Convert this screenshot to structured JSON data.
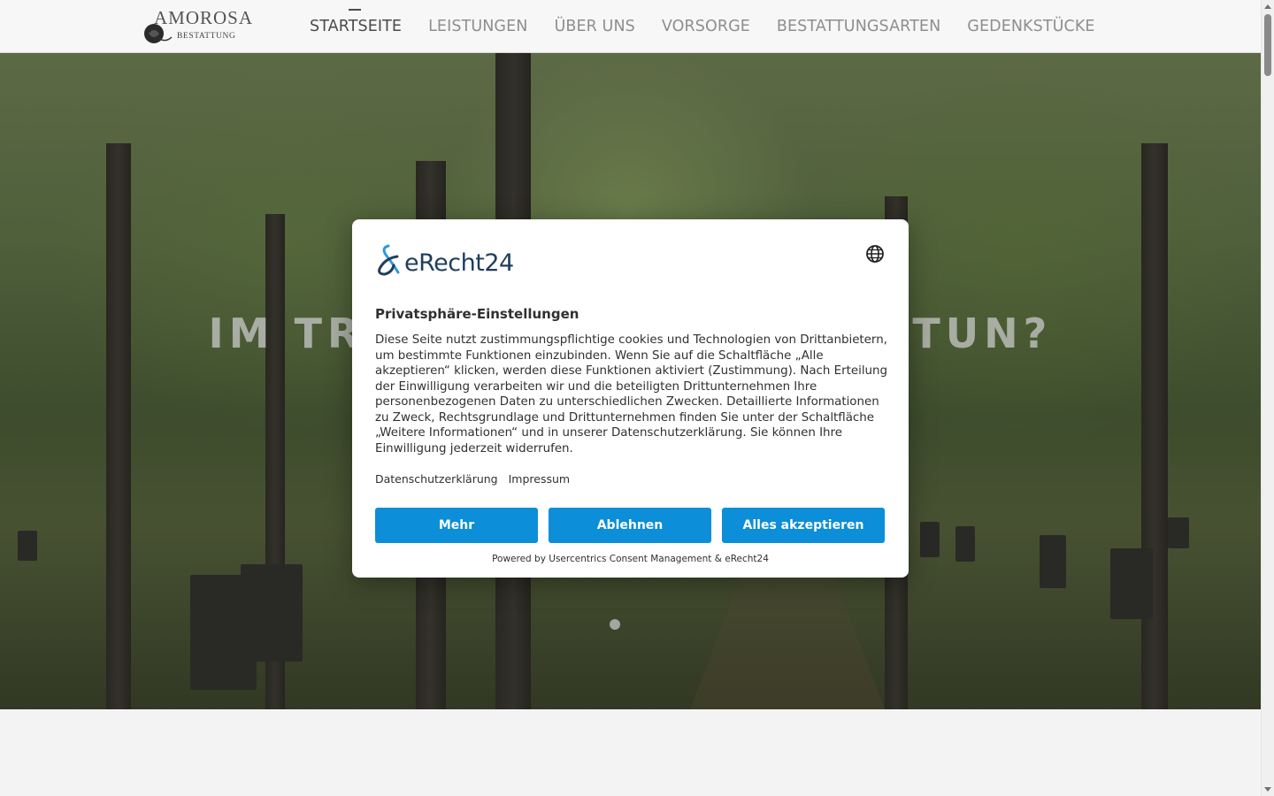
{
  "header": {
    "logo": {
      "wordmark": "AMOROSA",
      "subtitle": "BESTATTUNG"
    },
    "nav": [
      {
        "label": "STARTSEITE",
        "active": true
      },
      {
        "label": "LEISTUNGEN",
        "active": false
      },
      {
        "label": "ÜBER UNS",
        "active": false
      },
      {
        "label": "VORSORGE",
        "active": false
      },
      {
        "label": "BESTATTUNGSARTEN",
        "active": false
      },
      {
        "label": "GEDENKSTÜCKE",
        "active": false
      }
    ]
  },
  "hero": {
    "title_left": "IM TR",
    "title_right": "TUN?",
    "slides": 1
  },
  "consent": {
    "brand": "eRecht24",
    "language_icon": "globe-icon",
    "title": "Privatsphäre-Einstellungen",
    "text": "Diese Seite nutzt zustimmungspflichtige cookies und Technologien von Drittanbietern, um bestimmte Funktionen einzubinden. Wenn Sie auf die Schaltfläche „Alle akzeptieren“ klicken, werden diese Funktionen aktiviert (Zustimmung). Nach Erteilung der Einwilligung verarbeiten wir und die beteiligten Drittunternehmen Ihre personenbezogenen Daten zu unterschiedlichen Zwecken. Detaillierte Informationen zu Zweck, Rechtsgrundlage und Drittunternehmen finden Sie unter der Schaltfläche „Weitere Informationen“ und in unserer Datenschutzerklärung. Sie können Ihre Einwilligung jederzeit widerrufen.",
    "links": {
      "privacy": "Datenschutzerklärung",
      "imprint": "Impressum"
    },
    "buttons": {
      "more": "Mehr",
      "decline": "Ablehnen",
      "accept_all": "Alles akzeptieren"
    },
    "powered_by": "Powered by Usercentrics Consent Management & eRecht24",
    "button_color": "#0c8ed8"
  }
}
